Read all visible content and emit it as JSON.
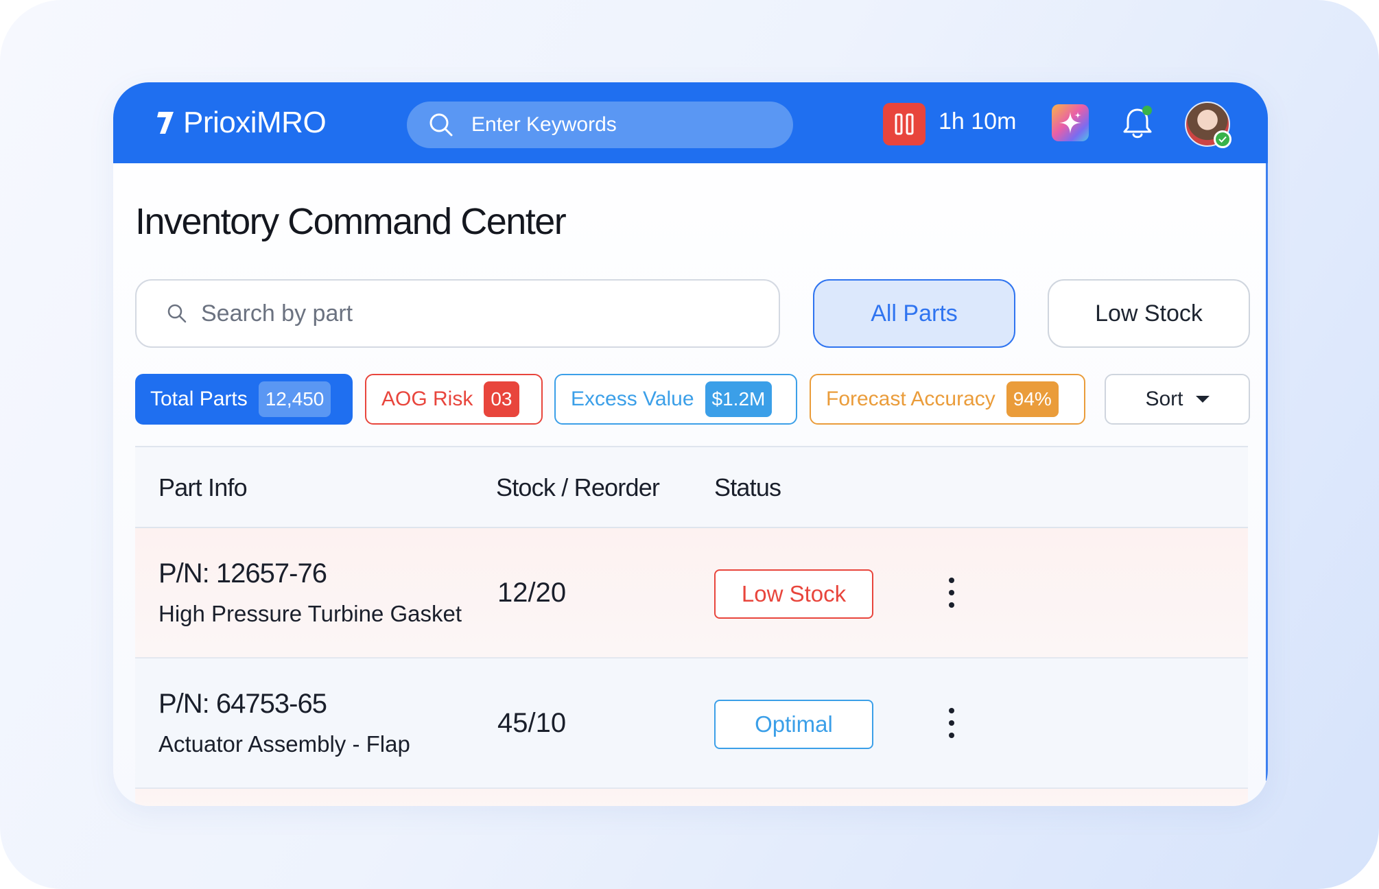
{
  "app": {
    "name": "PrioxiMRO"
  },
  "header": {
    "search_placeholder": "Enter Keywords",
    "timer": "1h 10m",
    "icons": [
      "logo-icon",
      "search-icon",
      "pause-icon",
      "ai-sparkle-icon",
      "bell-icon",
      "avatar"
    ]
  },
  "page": {
    "title": "Inventory Command Center"
  },
  "search": {
    "placeholder": "Search by part"
  },
  "filters": {
    "all": "All Parts",
    "low": "Low Stock",
    "active": "All Parts"
  },
  "chips": {
    "total": {
      "label": "Total Parts",
      "value": "12,450"
    },
    "aog": {
      "label": "AOG Risk",
      "value": "03"
    },
    "excess": {
      "label": "Excess Value",
      "value": "$1.2M"
    },
    "forecast": {
      "label": "Forecast Accuracy",
      "value": "94%"
    }
  },
  "sort": {
    "label": "Sort"
  },
  "table": {
    "columns": [
      "Part Info",
      "Stock / Reorder",
      "Status"
    ],
    "rows": [
      {
        "pn": "P/N: 12657-76",
        "name": "High Pressure Turbine Gasket",
        "stock": "12/20",
        "status": "Low Stock"
      },
      {
        "pn": "P/N: 64753-65",
        "name": "Actuator Assembly - Flap",
        "stock": "45/10",
        "status": "Optimal"
      }
    ]
  },
  "colors": {
    "primary": "#1f6ff0",
    "danger": "#e8453c",
    "info": "#3b9fe8",
    "warning": "#ea9c3a",
    "online": "#38b24a"
  }
}
